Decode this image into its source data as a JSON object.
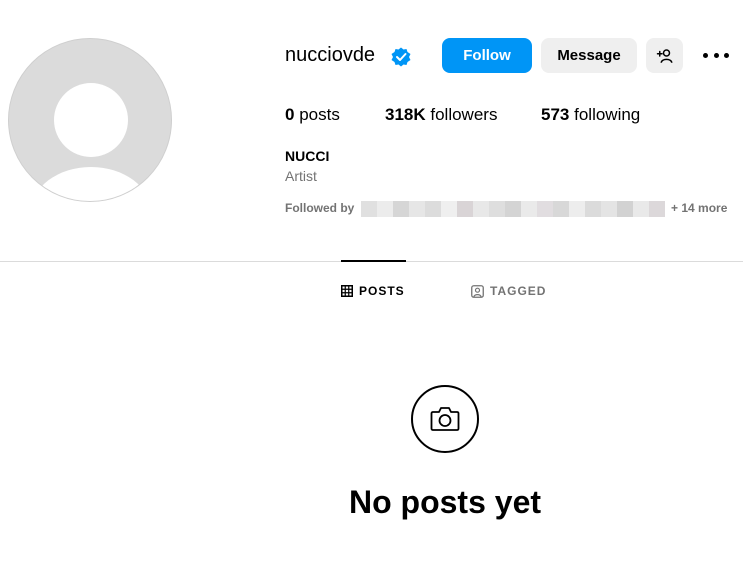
{
  "profile": {
    "username": "nucciovde",
    "verified": true,
    "full_name": "NUCCI",
    "category": "Artist"
  },
  "actions": {
    "follow_label": "Follow",
    "message_label": "Message",
    "add_user_icon": "add-person-icon",
    "more_icon": "more-options-icon"
  },
  "stats": {
    "posts": {
      "count": "0",
      "label": "posts"
    },
    "followers": {
      "count": "318K",
      "label": "followers"
    },
    "following": {
      "count": "573",
      "label": "following"
    }
  },
  "followed_by": {
    "label": "Followed by",
    "more": "+ 14 more"
  },
  "tabs": [
    {
      "label": "POSTS",
      "icon": "grid-icon",
      "active": true
    },
    {
      "label": "TAGGED",
      "icon": "tagged-icon",
      "active": false
    }
  ],
  "empty_state": {
    "icon": "camera-icon",
    "title": "No posts yet"
  },
  "colors": {
    "accent": "#0095f6",
    "verified": "#0095f6",
    "secondary_text": "#737373",
    "button_gray": "#efefef",
    "divider": "#dbdbdb"
  }
}
